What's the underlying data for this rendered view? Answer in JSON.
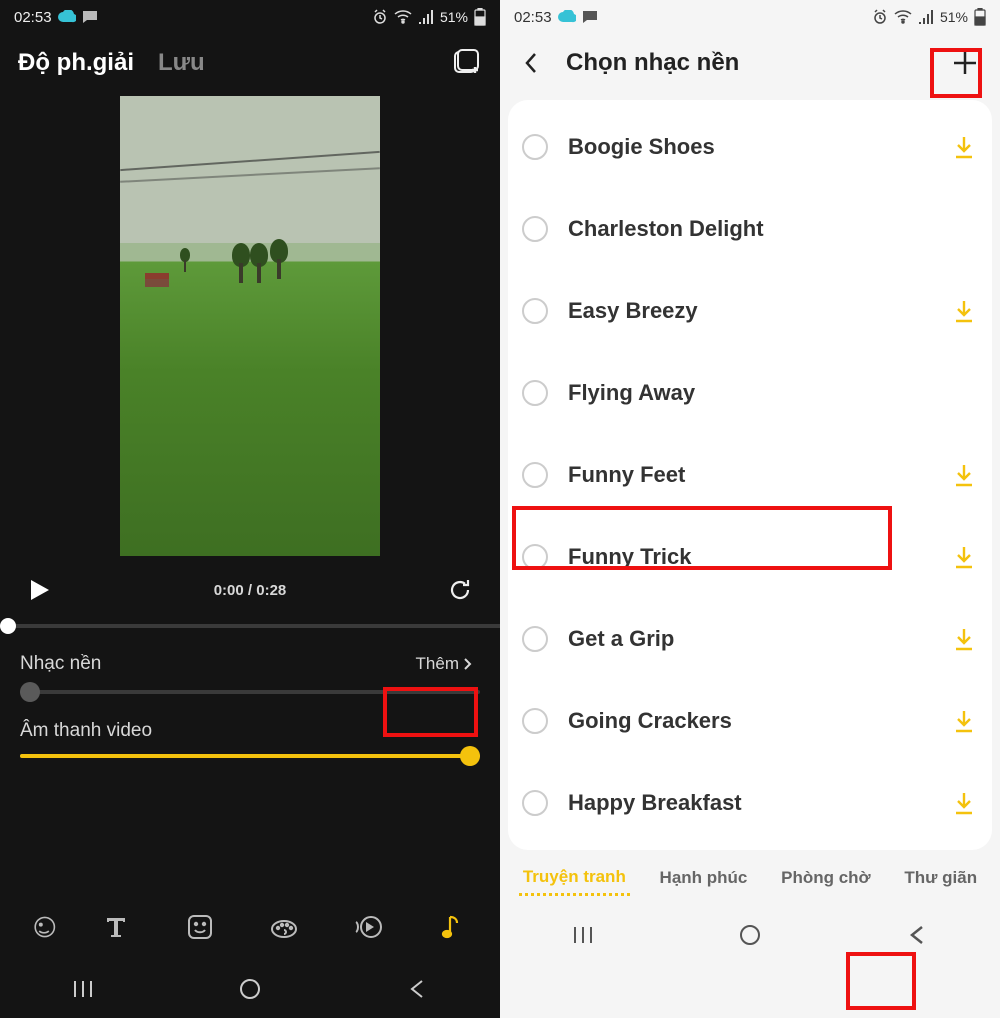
{
  "status": {
    "time": "02:53",
    "battery": "51%"
  },
  "left": {
    "resolution": "Độ ph.giải",
    "save": "Lưu",
    "timecode": "0:00 / 0:28",
    "bgmusic_label": "Nhạc nền",
    "more_label": "Thêm",
    "videoaudio_label": "Âm thanh video"
  },
  "right": {
    "title": "Chọn nhạc nền",
    "songs": [
      "Boogie Shoes",
      "Charleston Delight",
      "Easy Breezy",
      "Flying Away",
      "Funny Feet",
      "Funny Trick",
      "Get a Grip",
      "Going Crackers",
      "Happy Breakfast"
    ],
    "tabs": [
      "Truyện tranh",
      "Hạnh phúc",
      "Phòng chờ",
      "Thư giãn"
    ]
  }
}
